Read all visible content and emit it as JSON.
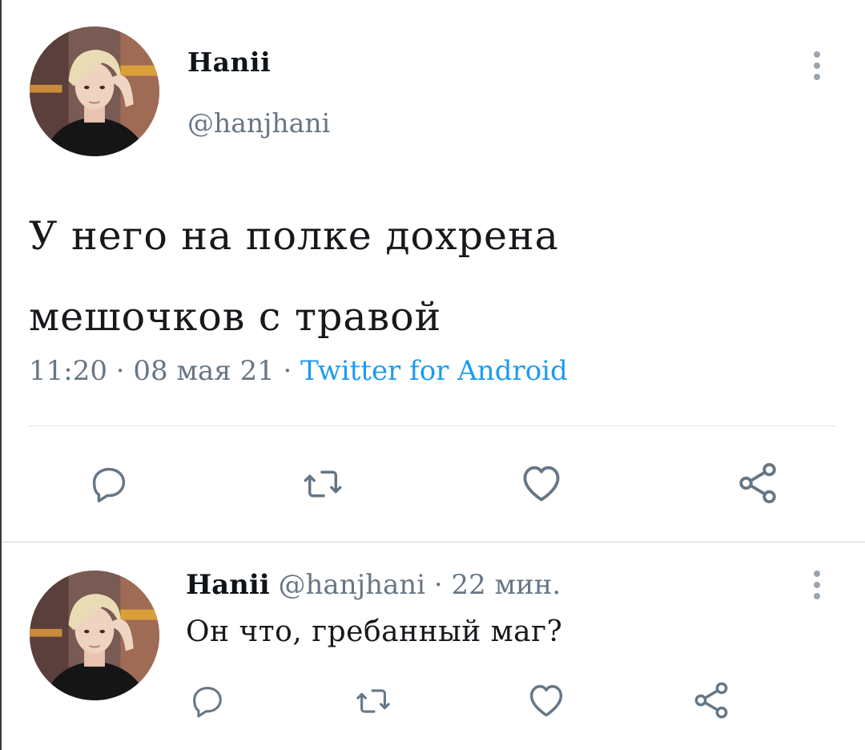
{
  "main_tweet": {
    "author_name": "Hanii",
    "author_handle": "@hanjhani",
    "text_line1": "У него на полке дохрена",
    "text_line2": "мешочков с травой",
    "time": "11:20",
    "date": "08 мая 21",
    "separator": "·",
    "source": "Twitter for Android"
  },
  "reply_tweet": {
    "author_name": "Hanii",
    "author_handle": "@hanjhani",
    "separator": "·",
    "age": "22 мин.",
    "text": "Он что, гребанный маг?"
  },
  "icons": {
    "reply": "reply-icon",
    "retweet": "retweet-icon",
    "like": "like-icon",
    "share": "share-icon",
    "more": "more-vertical-icon",
    "icon_color": "#657786",
    "link_color": "#1d9bf0"
  }
}
